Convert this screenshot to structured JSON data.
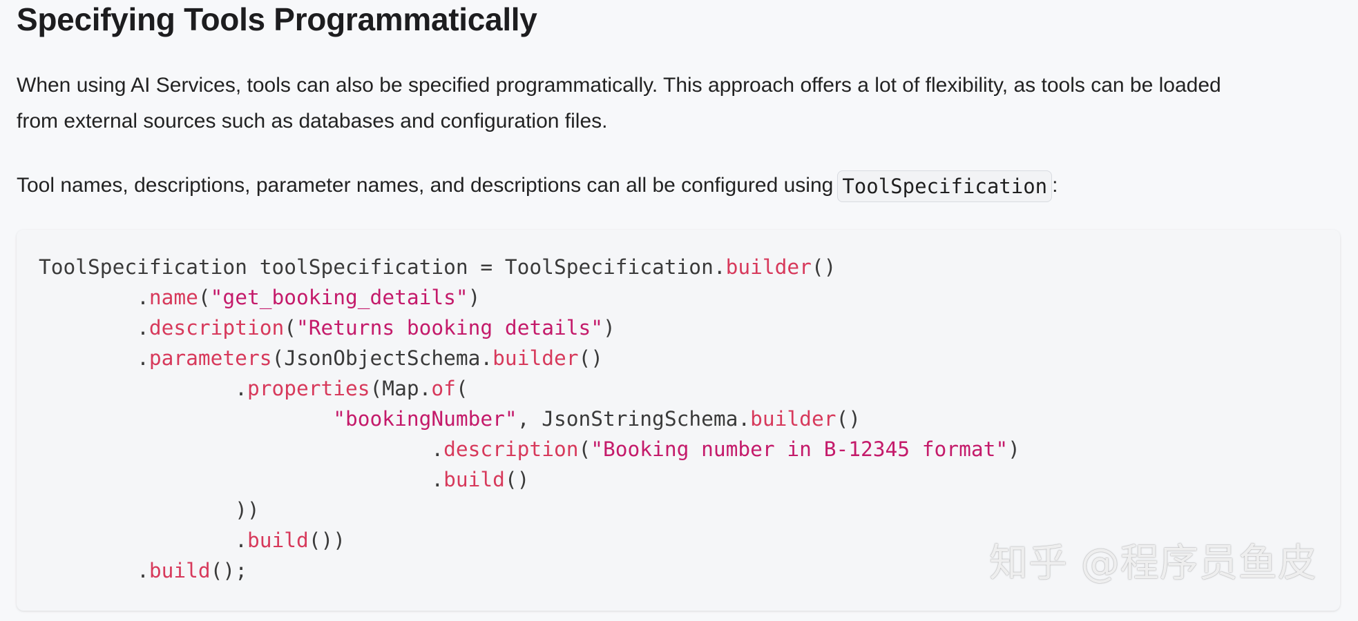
{
  "heading": "Specifying Tools Programmatically",
  "paragraph1": {
    "line1": "When using AI Services, tools can also be specified programmatically. This approach offers a lot of flexibility, as tools can be loaded",
    "line2": "from external sources such as databases and configuration files."
  },
  "paragraph2": {
    "text": "Tool names, descriptions, parameter names, and descriptions can all be configured using",
    "inline_code": "ToolSpecification",
    "trailing": ":"
  },
  "code_lines": [
    [
      [
        "p",
        "ToolSpecification toolSpecification = ToolSpecification."
      ],
      [
        "m",
        "builder"
      ],
      [
        "p",
        "()"
      ]
    ],
    [
      [
        "p",
        "        ."
      ],
      [
        "m",
        "name"
      ],
      [
        "p",
        "("
      ],
      [
        "s",
        "\"get_booking_details\""
      ],
      [
        "p",
        ")"
      ]
    ],
    [
      [
        "p",
        "        ."
      ],
      [
        "m",
        "description"
      ],
      [
        "p",
        "("
      ],
      [
        "s",
        "\"Returns booking details\""
      ],
      [
        "p",
        ")"
      ]
    ],
    [
      [
        "p",
        "        ."
      ],
      [
        "m",
        "parameters"
      ],
      [
        "p",
        "(JsonObjectSchema."
      ],
      [
        "m",
        "builder"
      ],
      [
        "p",
        "()"
      ]
    ],
    [
      [
        "p",
        "                ."
      ],
      [
        "m",
        "properties"
      ],
      [
        "p",
        "(Map."
      ],
      [
        "m",
        "of"
      ],
      [
        "p",
        "("
      ]
    ],
    [
      [
        "p",
        "                        "
      ],
      [
        "s",
        "\"bookingNumber\""
      ],
      [
        "p",
        ", JsonStringSchema."
      ],
      [
        "m",
        "builder"
      ],
      [
        "p",
        "()"
      ]
    ],
    [
      [
        "p",
        "                                ."
      ],
      [
        "m",
        "description"
      ],
      [
        "p",
        "("
      ],
      [
        "s",
        "\"Booking number in B-12345 format\""
      ],
      [
        "p",
        ")"
      ]
    ],
    [
      [
        "p",
        "                                ."
      ],
      [
        "m",
        "build"
      ],
      [
        "p",
        "()"
      ]
    ],
    [
      [
        "p",
        "                ))"
      ]
    ],
    [
      [
        "p",
        "                ."
      ],
      [
        "m",
        "build"
      ],
      [
        "p",
        "())"
      ]
    ],
    [
      [
        "p",
        "        ."
      ],
      [
        "m",
        "build"
      ],
      [
        "p",
        "();"
      ]
    ]
  ],
  "watermark": "知乎 @程序员鱼皮",
  "colors": {
    "background": "#f7f8fa",
    "method": "#d7395b",
    "string": "#c41a6a",
    "plain": "#3a3a3a"
  }
}
